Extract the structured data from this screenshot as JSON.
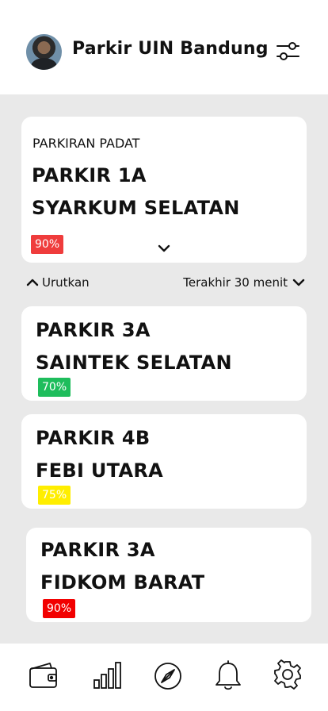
{
  "header": {
    "title": "Parkir UIN Bandung",
    "avatar_icon": "user-avatar",
    "filter_icon": "sliders-icon"
  },
  "hero": {
    "label": "PARKIRAN PADAT",
    "name_line1": "PARKIR 1A",
    "name_line2": "SYARKUM SELATAN",
    "occupancy": "90%",
    "badge_color": "#ef3c3c",
    "expand_icon": "chevron-down-icon"
  },
  "sort": {
    "sort_label": "Urutkan",
    "period_label": "Terakhir 30 menit"
  },
  "parking_list": [
    {
      "line1": "PARKIR 3A",
      "line2": "SAINTEK SELATAN",
      "occupancy": "70%",
      "color": "#1ebd5c"
    },
    {
      "line1": "PARKIR 4B",
      "line2": "FEBI UTARA",
      "occupancy": "75%",
      "color": "#ffee00"
    },
    {
      "line1": "PARKIR 3A",
      "line2": "FIDKOM BARAT",
      "occupancy": "90%",
      "color": "#f20000"
    }
  ],
  "bottom_nav": [
    {
      "icon": "wallet-icon"
    },
    {
      "icon": "bar-chart-icon"
    },
    {
      "icon": "compass-icon"
    },
    {
      "icon": "bell-icon"
    },
    {
      "icon": "gear-icon"
    }
  ]
}
